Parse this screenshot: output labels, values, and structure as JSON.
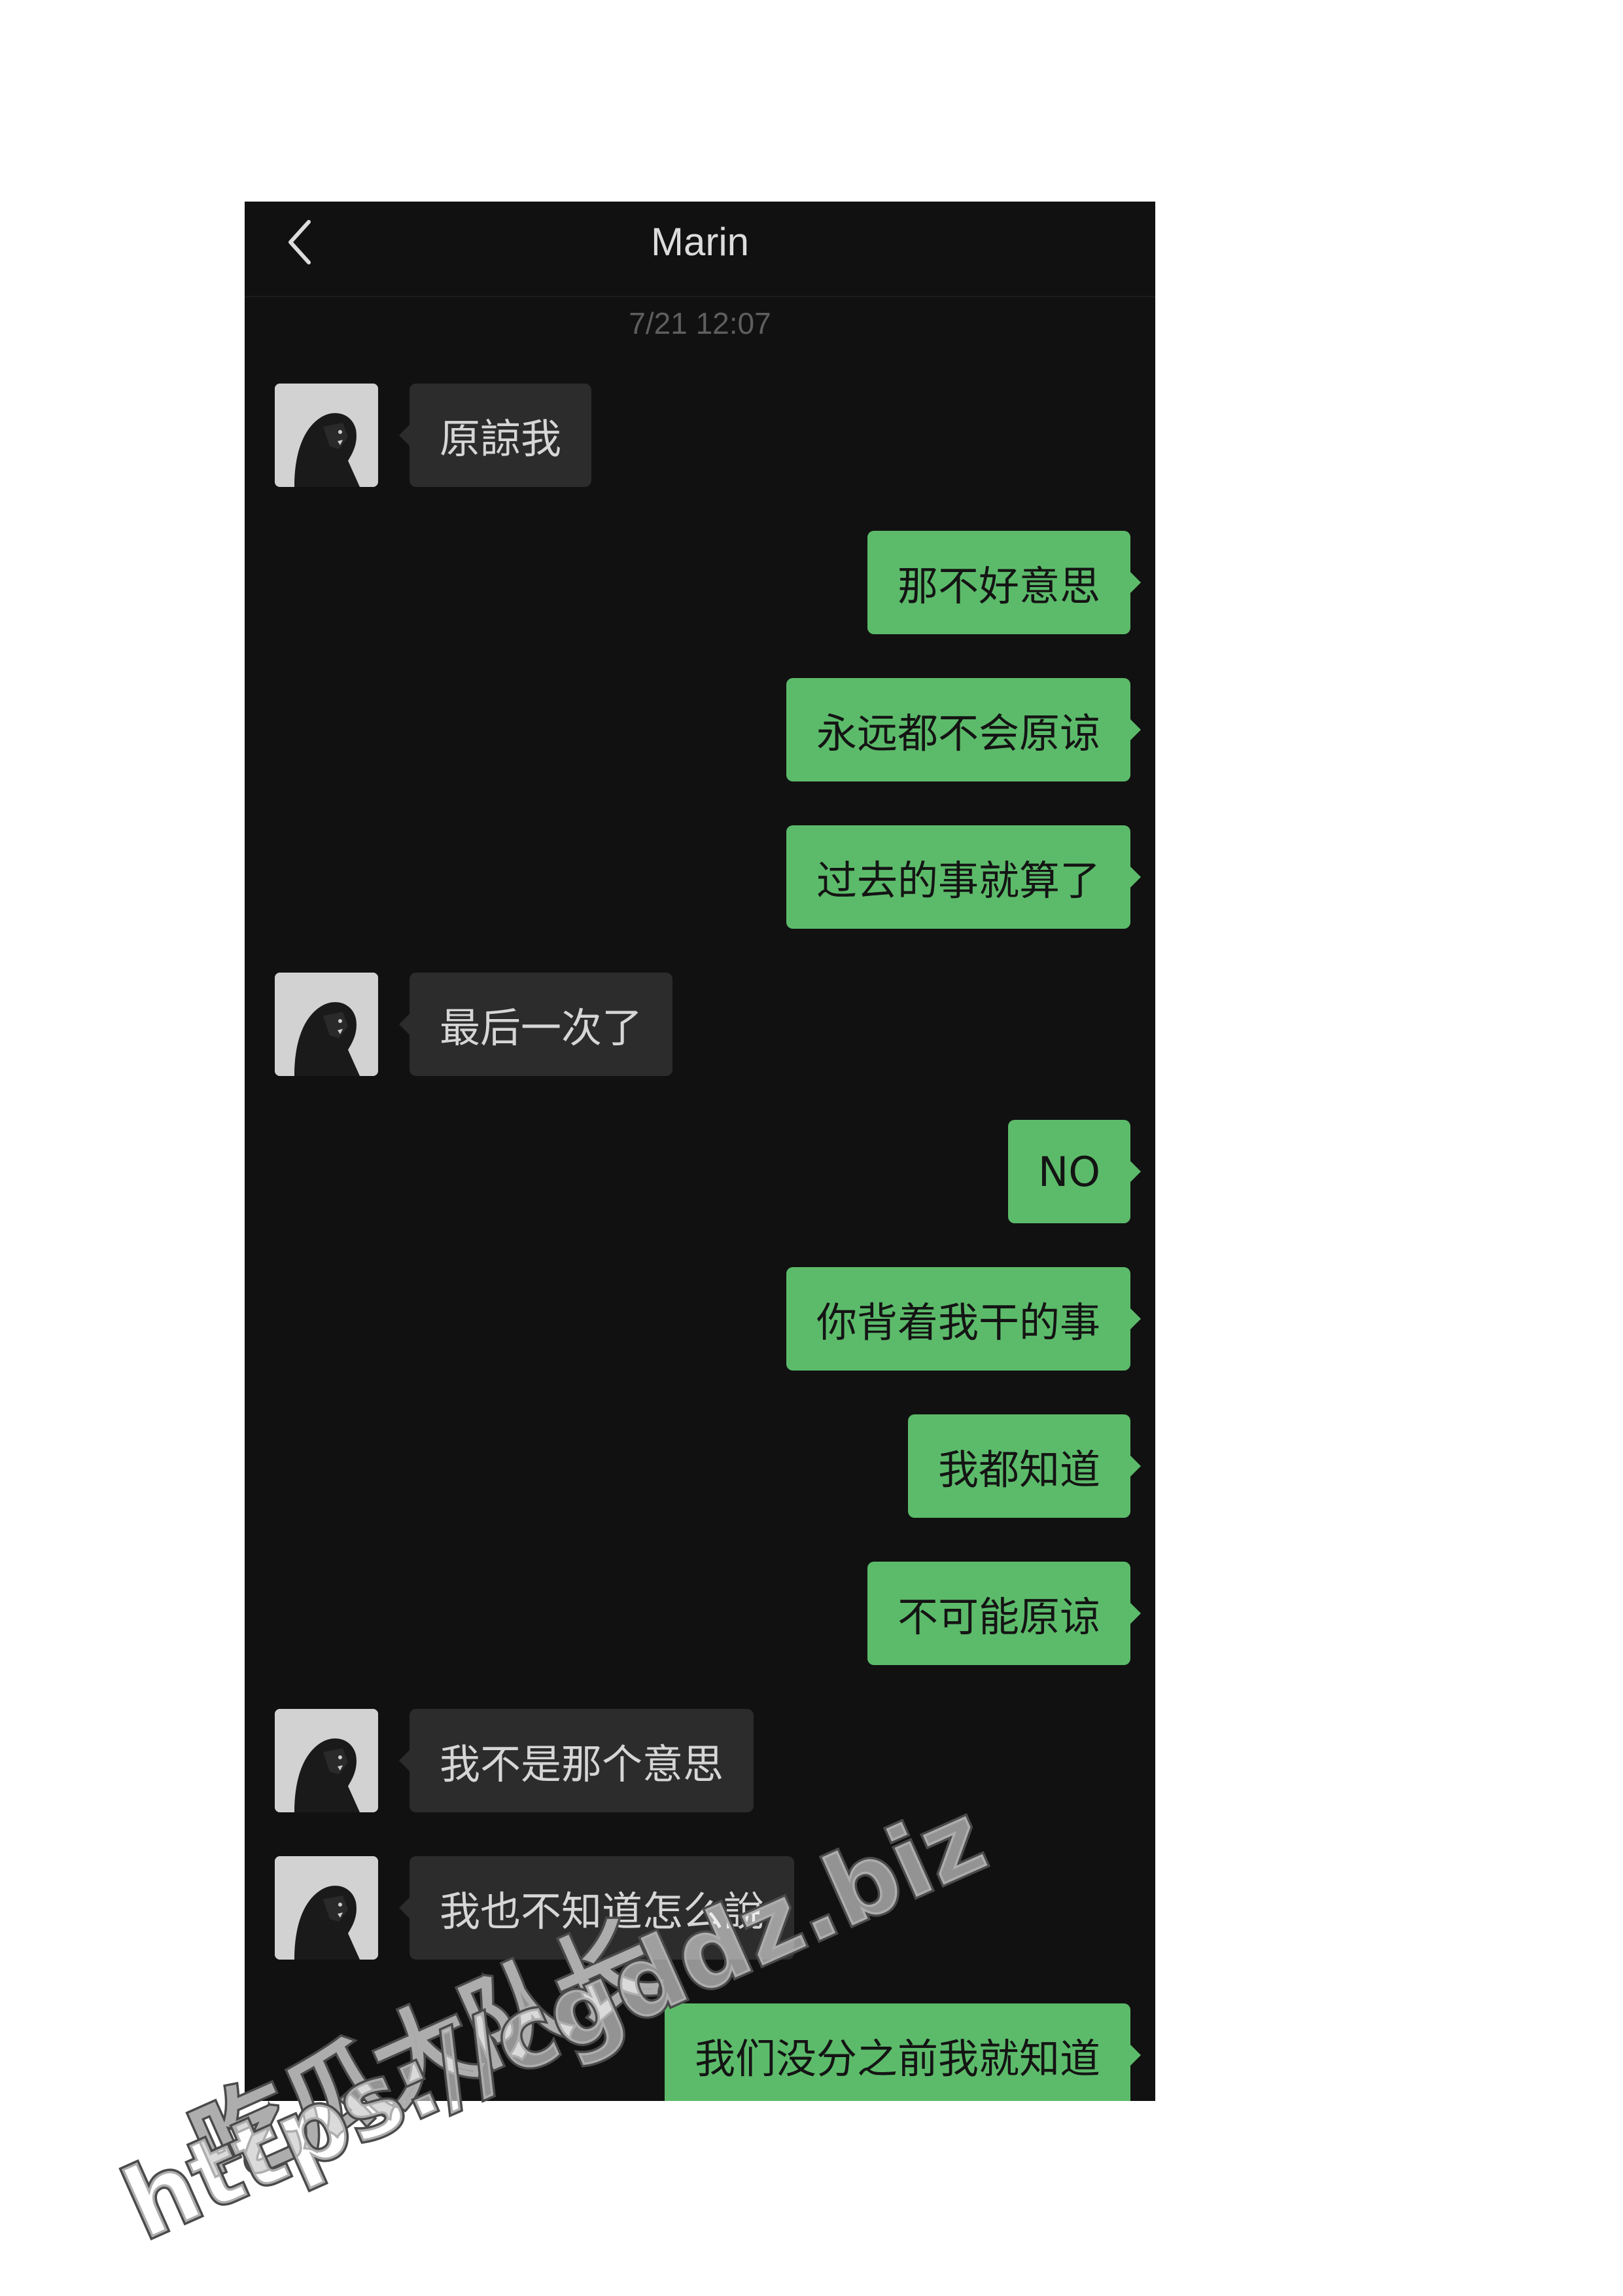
{
  "chat": {
    "title": "Marin",
    "back_icon": "chevron-left-icon",
    "timestamp": "7/21 12:07"
  },
  "messages": [
    {
      "direction": "in",
      "text": "原諒我"
    },
    {
      "direction": "out",
      "text": "那不好意思"
    },
    {
      "direction": "out",
      "text": "永远都不会原谅"
    },
    {
      "direction": "out",
      "text": "过去的事就算了"
    },
    {
      "direction": "in",
      "text": "最后一次了"
    },
    {
      "direction": "out",
      "text": "NO"
    },
    {
      "direction": "out",
      "text": "你背着我干的事"
    },
    {
      "direction": "out",
      "text": "我都知道"
    },
    {
      "direction": "out",
      "text": "不可能原谅"
    },
    {
      "direction": "in",
      "text": "我不是那个意思"
    },
    {
      "direction": "in",
      "text": "我也不知道怎么說"
    },
    {
      "direction": "out",
      "text": "我们没分之前我就知道"
    }
  ],
  "watermark": {
    "line1": "吃瓜大队长",
    "line2": "https://cgddz.biz"
  },
  "colors": {
    "chat_background": "#111111",
    "incoming_bubble": "#2c2c2c",
    "outgoing_bubble": "#5cbb6a"
  }
}
